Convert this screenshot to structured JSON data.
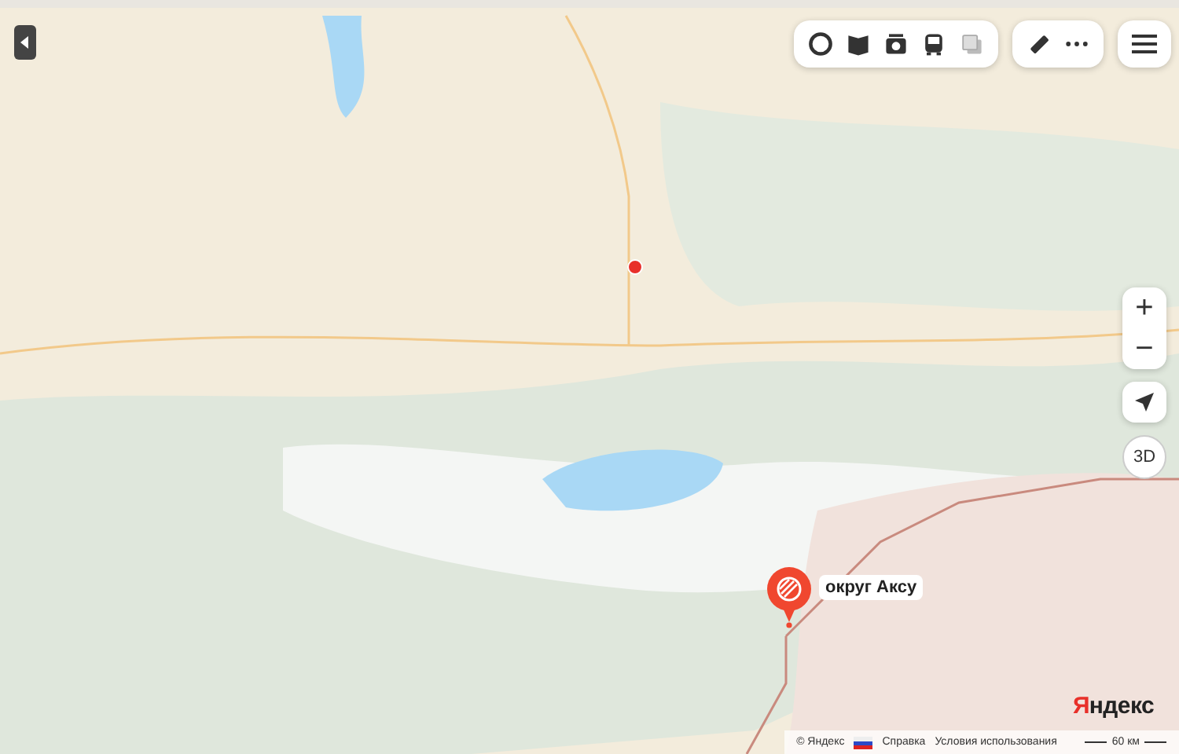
{
  "zoom_buttons": [
    "+",
    "−"
  ],
  "view_button": "3D",
  "place": {
    "label": "округ Аксу"
  },
  "logo": "Яндекс",
  "footer": {
    "copyright": "© Яндекс",
    "links": [
      "Справка",
      "Условия использования"
    ],
    "scale": "60 км"
  }
}
